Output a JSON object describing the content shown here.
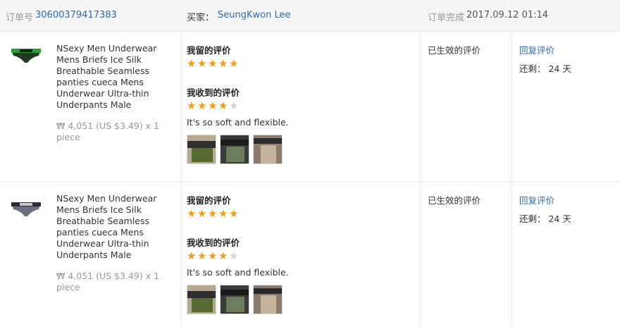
{
  "header": {
    "order_no_label": "订单号",
    "order_no": "30600379417383",
    "buyer_label": "买家：",
    "buyer_name": "SeungKwon Lee",
    "completed_label": "订单完成",
    "completed_time": "2017.09.12 01:14"
  },
  "items": [
    {
      "title": "NSexy Men Underwear Mens Briefs Ice Silk Breathable Seamless panties cueca Mens Underwear Ultra-thin Underpants Male",
      "price": "₩ 4,051 (US $3.49) x 1 piece",
      "my_review_label": "我留的评价",
      "my_rating": 5,
      "received_label": "我收到的评价",
      "received_rating": 4,
      "review_text": "It's so soft and flexible.",
      "status": "已生效的评价",
      "reply_label": "回复评价",
      "remaining": "还剩： 24 天",
      "thumb_color": "#1f3a1f",
      "thumb_band": "#3fb84a"
    },
    {
      "title": "NSexy Men Underwear Mens Briefs Ice Silk Breathable Seamless panties cueca Mens Underwear Ultra-thin Underpants Male",
      "price": "₩ 4,051 (US $3.49) x 1 piece",
      "my_review_label": "我留的评价",
      "my_rating": 5,
      "received_label": "我收到的评价",
      "received_rating": 4,
      "review_text": "It's so soft and flexible.",
      "status": "已生效的评价",
      "reply_label": "回复评价",
      "remaining": "还剩： 24 天",
      "thumb_color": "#5a6070",
      "thumb_band": "#2a2d35"
    }
  ]
}
